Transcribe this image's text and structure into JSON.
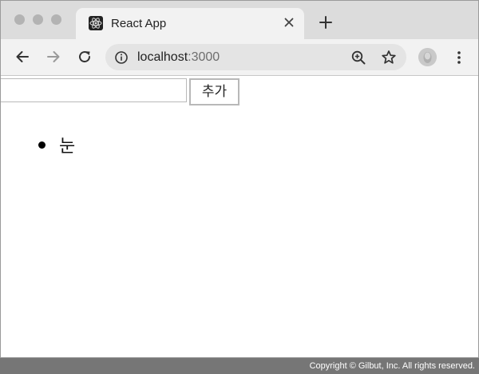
{
  "browser": {
    "tab": {
      "title": "React App",
      "favicon": "react-atom-icon"
    },
    "toolbar": {
      "url_host": "localhost",
      "url_port": ":3000"
    }
  },
  "page": {
    "input": {
      "value": "",
      "placeholder": ""
    },
    "add_button_label": "추가",
    "items": [
      "눈"
    ]
  },
  "footer": {
    "copyright": "Copyright © Gilbut, Inc. All rights reserved."
  },
  "colors": {
    "tabstrip": "#dcdcdc",
    "toolbar": "#f2f2f2",
    "omnibox": "#e4e4e4",
    "footer": "#767676"
  }
}
